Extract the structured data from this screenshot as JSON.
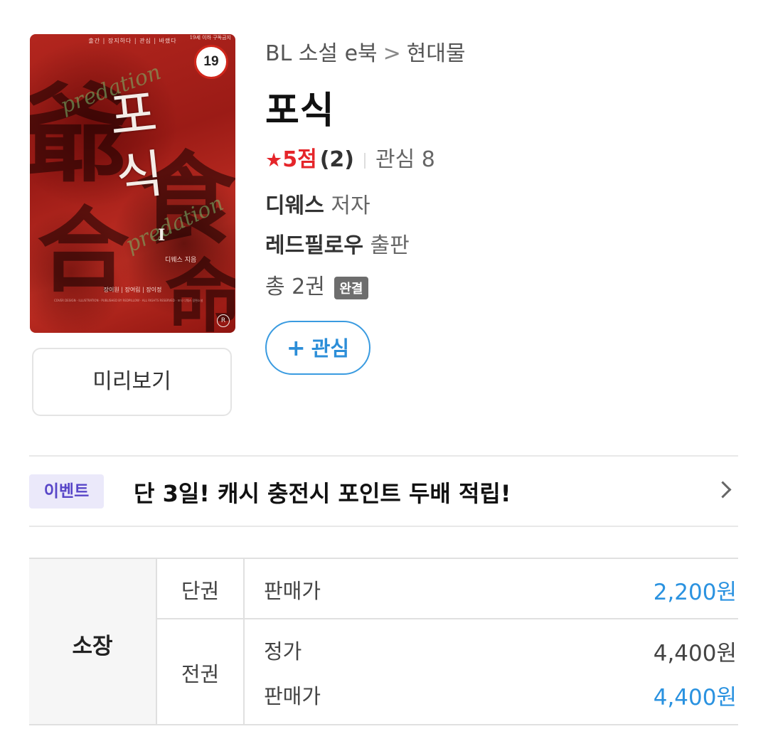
{
  "cover": {
    "ribbon": "출간  |  장지하다  |  관심  |  바랬다",
    "corner_text": "19세 이하 구독금지",
    "title": "포식",
    "volume": "I",
    "author": "디웨스 지음",
    "credits": "장이원 | 장여림 | 장이정",
    "blurb": "COVER DESIGN · ILLUSTRATION · PUBLISHED BY REDPILLOW · ALL RIGHTS RESERVED · 포식 디웨스 장편소설",
    "script_text": "predation",
    "logo": "R",
    "age_badge": "19"
  },
  "preview_button": {
    "label": "미리보기"
  },
  "breadcrumb": {
    "category": "BL 소설 e북",
    "separator": ">",
    "subcategory": "현대물"
  },
  "title": "포식",
  "rating": {
    "star_icon": "★",
    "score": "5점",
    "count": "(2)",
    "interest_label": "관심",
    "interest_count": "8"
  },
  "author": {
    "name": "디웨스",
    "role": "저자"
  },
  "publisher": {
    "name": "레드필로우",
    "role": "출판"
  },
  "volumes": {
    "text": "총 2권",
    "status_badge": "완결"
  },
  "follow_button": {
    "icon": "+",
    "label": "관심"
  },
  "event": {
    "tag": "이벤트",
    "text": "단 3일! 캐시 충전시 포인트 두배 적립!"
  },
  "price_table": {
    "ownership_label": "소장",
    "single": {
      "type": "단권",
      "sale_label": "판매가",
      "sale_price": "2,200원"
    },
    "full": {
      "type": "전권",
      "list_label": "정가",
      "list_price": "4,400원",
      "sale_label": "판매가",
      "sale_price": "4,400원"
    }
  },
  "colors": {
    "accent_blue": "#2a92e0",
    "star_red": "#e5252a",
    "event_purple": "#5846c8",
    "badge_gray": "#6d6d6d"
  }
}
